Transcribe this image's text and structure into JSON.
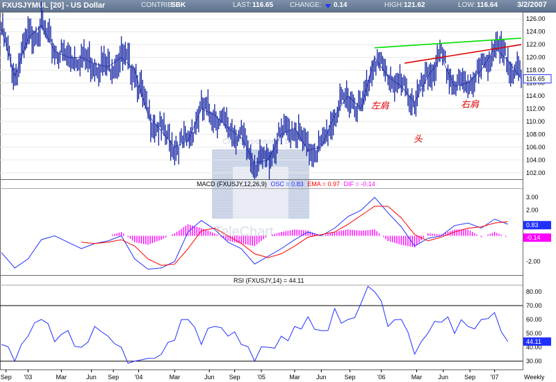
{
  "header": {
    "symbol_title": "FXUSJYMUL [20] - US Dollar",
    "contrib_label": "CONTRIB:",
    "contrib_value": "SBK",
    "last_label": "LAST:",
    "last_value": "116.65",
    "change_label": "CHANGE:",
    "change_value": "0.14",
    "high_label": "HIGH:",
    "high_value": "121.62",
    "low_label": "LOW:",
    "low_value": "116.64",
    "date": "3/2/2007"
  },
  "watermark": {
    "sponsor_text": "Charts sponsored by",
    "brand_text": "TeleChart"
  },
  "colors": {
    "price": "#1020a0",
    "macd": "#2030ff",
    "macd_signal": "#ff0000",
    "histogram": "#ff00ff",
    "rsi": "#2030ff",
    "neckline_green": "#00dd00",
    "neckline_red": "#dd0000",
    "annotation": "#dd0000"
  },
  "chart_data": [
    {
      "type": "line",
      "panel": "price",
      "title": "",
      "ylim": [
        101,
        127
      ],
      "yticks": [
        "126.00",
        "124.00",
        "122.00",
        "120.00",
        "118.00",
        "116.00",
        "114.00",
        "112.00",
        "110.00",
        "108.00",
        "106.00",
        "104.00",
        "102.00"
      ],
      "ytick_values": [
        126,
        124,
        122,
        120,
        118,
        116,
        114,
        112,
        110,
        108,
        106,
        104,
        102
      ],
      "last_label": "116.65",
      "x_ticks": [
        "Sep",
        "'03",
        "Mar",
        "Jun",
        "Sep",
        "'04",
        "Mar",
        "Jun",
        "Sep",
        "'05",
        "Mar",
        "Jun",
        "Sep",
        "'06",
        "Mar",
        "Jun",
        "Sep",
        "'07",
        "Weekly"
      ],
      "x_tick_t": [
        0.7,
        4,
        9,
        13.5,
        16.8,
        20.6,
        26,
        31.2,
        35,
        39,
        44,
        48,
        52.3,
        57,
        62.3,
        66.3,
        70.3,
        74,
        78
      ],
      "t": [
        0,
        2,
        4,
        6,
        8,
        10,
        12,
        14,
        16,
        18,
        20,
        22,
        24,
        26,
        28,
        30,
        32,
        34,
        36,
        38,
        40,
        42,
        44,
        46,
        48,
        50,
        52,
        54,
        56,
        58,
        60,
        62,
        64,
        66,
        68,
        70,
        72,
        74,
        76,
        78
      ],
      "values": [
        124.5,
        117,
        123,
        125,
        121,
        120,
        120,
        119,
        118.5,
        120,
        118,
        111,
        108.5,
        106,
        107,
        112,
        111,
        109,
        107.5,
        103.5,
        104,
        108,
        109,
        105.5,
        106,
        111,
        114,
        112,
        120,
        117,
        115.5,
        113,
        117,
        120,
        115.5,
        116,
        118,
        121.5,
        119.5,
        116.65
      ],
      "annotations": [
        {
          "text": "左肩",
          "t": 56.8,
          "y": 112
        },
        {
          "text": "头",
          "t": 62.5,
          "y": 106.8
        },
        {
          "text": "右肩",
          "t": 70.3,
          "y": 112.2
        }
      ],
      "trendlines": [
        {
          "color": "green",
          "t0": 56,
          "y0": 121.5,
          "t1": 78,
          "y1": 123
        },
        {
          "color": "red",
          "t0": 60.5,
          "y0": 119.1,
          "t1": 78,
          "y1": 122
        }
      ]
    },
    {
      "type": "line",
      "panel": "macd",
      "title": "MACD (FXUSJY,12,26,9)",
      "osc_label": "OSC = 0.83",
      "ema_label": "EMA = 0.97",
      "dif_label": "DIF = -0.14",
      "ylim": [
        -3.0,
        3.6
      ],
      "yticks": [
        "3.00",
        "2.00",
        "-2.00"
      ],
      "ytick_values": [
        3,
        2,
        -2
      ],
      "box_labels": [
        "0.83",
        "-0.14"
      ],
      "box_values": [
        0.83,
        -0.14
      ],
      "t": [
        0,
        2,
        4,
        6,
        8,
        10,
        12,
        14,
        16,
        18,
        20,
        22,
        24,
        26,
        28,
        30,
        32,
        34,
        36,
        38,
        40,
        42,
        44,
        46,
        48,
        50,
        52,
        54,
        56,
        58,
        60,
        62,
        64,
        66,
        68,
        70,
        72,
        74,
        76
      ],
      "series": [
        {
          "name": "MACD",
          "values": [
            -1.3,
            -2.5,
            -1.8,
            -0.3,
            0.0,
            -0.5,
            -1.0,
            -0.6,
            -0.4,
            0.0,
            -1.8,
            -2.6,
            -2.5,
            -2.0,
            0.3,
            1.2,
            0.5,
            -0.5,
            -1.0,
            -2.2,
            -1.6,
            -1.0,
            -0.3,
            0.3,
            0.0,
            0.6,
            1.5,
            2.0,
            3.0,
            1.8,
            0.7,
            -0.8,
            -0.2,
            0.0,
            0.8,
            1.0,
            0.6,
            1.3,
            0.9
          ]
        },
        {
          "name": "EMA",
          "values": [
            null,
            null,
            null,
            null,
            null,
            null,
            -0.5,
            -0.6,
            -0.5,
            -0.3,
            -0.8,
            -1.8,
            -2.3,
            -2.2,
            -1.0,
            0.4,
            0.6,
            0.0,
            -0.6,
            -1.4,
            -1.7,
            -1.4,
            -0.8,
            -0.1,
            0.1,
            0.3,
            0.9,
            1.6,
            2.3,
            2.3,
            1.4,
            0.1,
            -0.4,
            -0.1,
            0.3,
            0.6,
            0.7,
            1.0,
            1.1
          ]
        },
        {
          "name": "DIF",
          "values": [
            0,
            0,
            0,
            0,
            0,
            0,
            0,
            0,
            0,
            0.3,
            -0.5,
            -0.7,
            -0.3,
            0.2,
            0.9,
            0.6,
            0.2,
            -0.4,
            -0.6,
            -0.8,
            0.0,
            0.3,
            0.5,
            0.4,
            0.0,
            0.3,
            0.5,
            0.4,
            0.5,
            -0.4,
            -0.7,
            -0.9,
            0.2,
            0.1,
            0.5,
            0.5,
            -0.1,
            0.3,
            -0.14
          ]
        }
      ]
    },
    {
      "type": "line",
      "panel": "rsi",
      "title": "RSI (FXUSJY,14) = 44.11",
      "ylim": [
        24,
        84
      ],
      "yticks": [
        "80.00",
        "70.00",
        "60.00",
        "50.00",
        "40.00",
        "30.00"
      ],
      "ytick_values": [
        80,
        70,
        60,
        50,
        40,
        30
      ],
      "box_label": "44.11",
      "reference_lines": [
        70,
        30
      ],
      "t": [
        0,
        2,
        4,
        6,
        8,
        10,
        12,
        14,
        16,
        18,
        20,
        22,
        24,
        26,
        28,
        30,
        32,
        34,
        36,
        38,
        40,
        42,
        44,
        46,
        48,
        50,
        52,
        54,
        56,
        58,
        60,
        62,
        64,
        66,
        68,
        70,
        72,
        74,
        76
      ],
      "values": [
        42,
        30,
        48,
        60,
        44,
        52,
        40,
        55,
        48,
        40,
        30,
        32,
        35,
        45,
        60,
        42,
        55,
        48,
        42,
        30,
        40,
        48,
        55,
        62,
        52,
        68,
        60,
        72,
        80,
        55,
        60,
        35,
        50,
        58,
        50,
        55,
        60,
        65,
        44
      ]
    }
  ]
}
